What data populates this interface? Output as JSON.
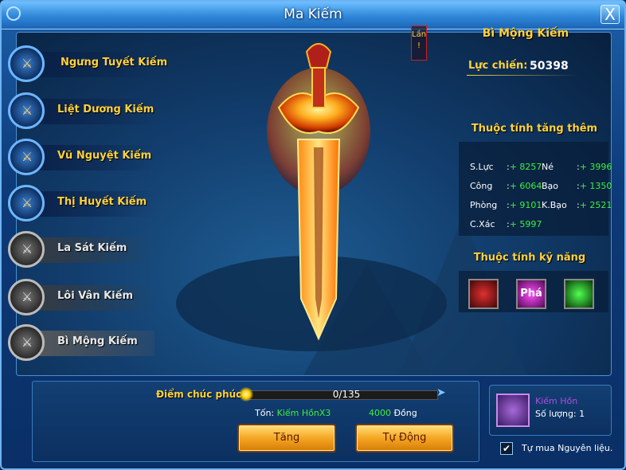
{
  "window": {
    "title": "Ma Kiếm",
    "close_label": "X"
  },
  "swords": [
    {
      "name": "Ngưng Tuyết Kiếm",
      "locked": false,
      "selected": false
    },
    {
      "name": "Liệt Dương Kiếm",
      "locked": false,
      "selected": false
    },
    {
      "name": "Vũ Nguyệt Kiếm",
      "locked": false,
      "selected": false
    },
    {
      "name": "Thị Huyết Kiếm",
      "locked": false,
      "selected": false
    },
    {
      "name": "La Sát Kiếm",
      "locked": true,
      "selected": false
    },
    {
      "name": "Lôi Vân Kiếm",
      "locked": true,
      "selected": false
    },
    {
      "name": "Bì Mộng Kiếm",
      "locked": true,
      "selected": true
    }
  ],
  "lan_badge": "Lần\n!",
  "detail": {
    "name": "Bì Mộng Kiếm",
    "power_label": "Lực chiến:",
    "power_value": "50398",
    "bonus_title": "Thuộc tính tăng thêm",
    "skills_title": "Thuộc tính kỹ năng",
    "stats": [
      {
        "key": "S.Lực",
        "value": "+ 8257"
      },
      {
        "key": "Né",
        "value": "+ 3996"
      },
      {
        "key": "Công",
        "value": "+ 6064"
      },
      {
        "key": "Bạo",
        "value": "+ 1350"
      },
      {
        "key": "Phòng",
        "value": "+ 9101"
      },
      {
        "key": "K.Bạo",
        "value": "+ 2521"
      },
      {
        "key": "C.Xác",
        "value": "+ 5997"
      }
    ],
    "skills": [
      {
        "icon": "blood-slash-icon",
        "color": "#c02020"
      },
      {
        "icon": "pha-icon",
        "label": "Phá",
        "color": "#c020c0"
      },
      {
        "icon": "green-swirl-icon",
        "color": "#20b020"
      }
    ]
  },
  "bless": {
    "label": "Điểm chúc phúc:",
    "current": 0,
    "max": 135,
    "text": "0/135"
  },
  "cost": {
    "label": "Tốn:",
    "item": "Kiếm HồnX3",
    "gold": "4000",
    "gold_unit": "Đồng"
  },
  "buttons": {
    "upgrade": "Tăng",
    "auto": "Tự Động"
  },
  "material": {
    "name": "Kiếm Hồn",
    "qty_label": "Số lượng: 1"
  },
  "auto_buy": {
    "checked": true,
    "label": "Tự mua Nguyên liệu."
  },
  "colors": {
    "gold": "#ffd23a",
    "green": "#3cf03c",
    "frame": "#1c5fa8"
  }
}
